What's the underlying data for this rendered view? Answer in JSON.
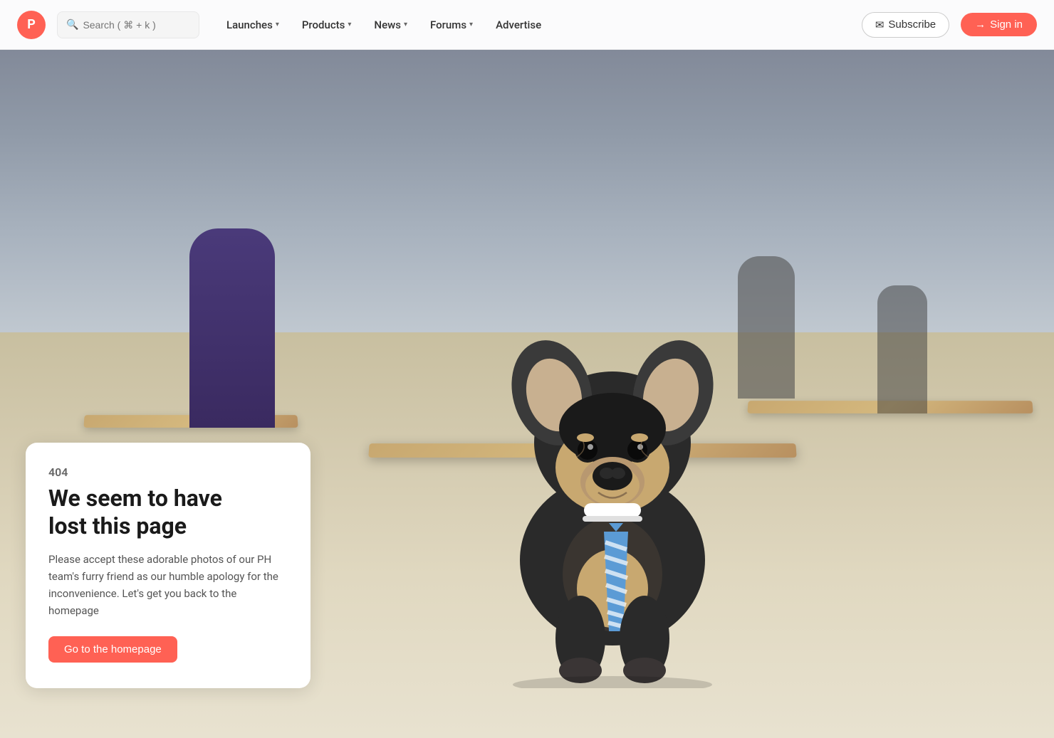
{
  "nav": {
    "logo_letter": "P",
    "search_placeholder": "Search ( ⌘ + k )",
    "links": [
      {
        "label": "Launches",
        "has_dropdown": true
      },
      {
        "label": "Products",
        "has_dropdown": true
      },
      {
        "label": "News",
        "has_dropdown": true
      },
      {
        "label": "Forums",
        "has_dropdown": true
      },
      {
        "label": "Advertise",
        "has_dropdown": false
      }
    ],
    "subscribe_label": "Subscribe",
    "signin_label": "Sign in"
  },
  "error": {
    "code": "404",
    "title_line1": "We seem to have",
    "title_line2": "lost this page",
    "description": "Please accept these adorable photos of our PH team's furry friend as our humble apology for the inconvenience. Let's get you back to the homepage",
    "cta_label": "Go to the homepage"
  },
  "colors": {
    "accent": "#ff6154",
    "text_dark": "#1a1a1a",
    "text_muted": "#666666"
  }
}
